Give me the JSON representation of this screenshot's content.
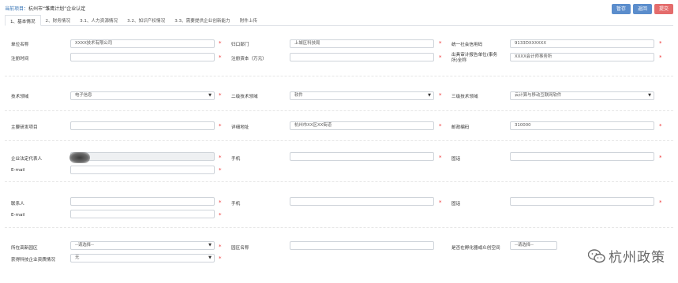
{
  "breadcrumb": {
    "prefix": "当前项目：",
    "title": "杭州市“雏鹰计划”企业认定"
  },
  "actions": {
    "save": "暂存",
    "back": "返回",
    "submit": "提交"
  },
  "tabs": [
    "1、基本情况",
    "2、财务情况",
    "3.1、人力资源情况",
    "3.2、知识产权情况",
    "3.3、需要提供企业创新能力",
    "附件上传"
  ],
  "form": {
    "company_name": {
      "label": "单位名称",
      "value": "XXXX技术有限公司"
    },
    "department": {
      "label": "归口部门",
      "value": "上城区科技局"
    },
    "credit_code": {
      "label": "统一社会信用码",
      "value": "9133DXXXXXX"
    },
    "reg_date": {
      "label": "注册时间",
      "value": ""
    },
    "reg_capital": {
      "label": "注册资本（万元）",
      "value": ""
    },
    "audit_firm": {
      "label": "出具审计报告单位(事务所)全称",
      "value": "XXXX会计师事务所"
    },
    "tech_field": {
      "label": "技术领域",
      "value": "电子信息"
    },
    "tech_field2": {
      "label": "二级技术领域",
      "value": "软件"
    },
    "tech_field3": {
      "label": "三级技术领域",
      "value": "云计算与移动互联网软件"
    },
    "main_product": {
      "label": "主要研发项目",
      "value": ""
    },
    "address": {
      "label": "详细地址",
      "value": "杭州市XX区XX街道"
    },
    "postcode": {
      "label": "邮政编码",
      "value": "310000"
    },
    "legal_rep": {
      "label": "企业法定代表人",
      "value": ""
    },
    "legal_phone": {
      "label": "手机",
      "value": ""
    },
    "legal_tel": {
      "label": "固话",
      "value": ""
    },
    "legal_email": {
      "label": "E-mail",
      "value": ""
    },
    "contact": {
      "label": "联系人",
      "value": ""
    },
    "contact_phone": {
      "label": "手机",
      "value": ""
    },
    "contact_tel": {
      "label": "固话",
      "value": ""
    },
    "contact_email": {
      "label": "E-mail",
      "value": ""
    },
    "district": {
      "label": "所在高新园区",
      "value": "--请选择--"
    },
    "park_name": {
      "label": "园区名称",
      "value": ""
    },
    "incubator": {
      "label": "是否在孵化器或众创空间",
      "value": "--请选择--"
    },
    "sci_company": {
      "label": "获得科技企业资质情况",
      "value": "无"
    }
  },
  "watermark": {
    "text": "杭州政策"
  },
  "colors": {
    "accent": "#5b8dcc",
    "danger": "#e46c6c",
    "required": "#e33333"
  }
}
